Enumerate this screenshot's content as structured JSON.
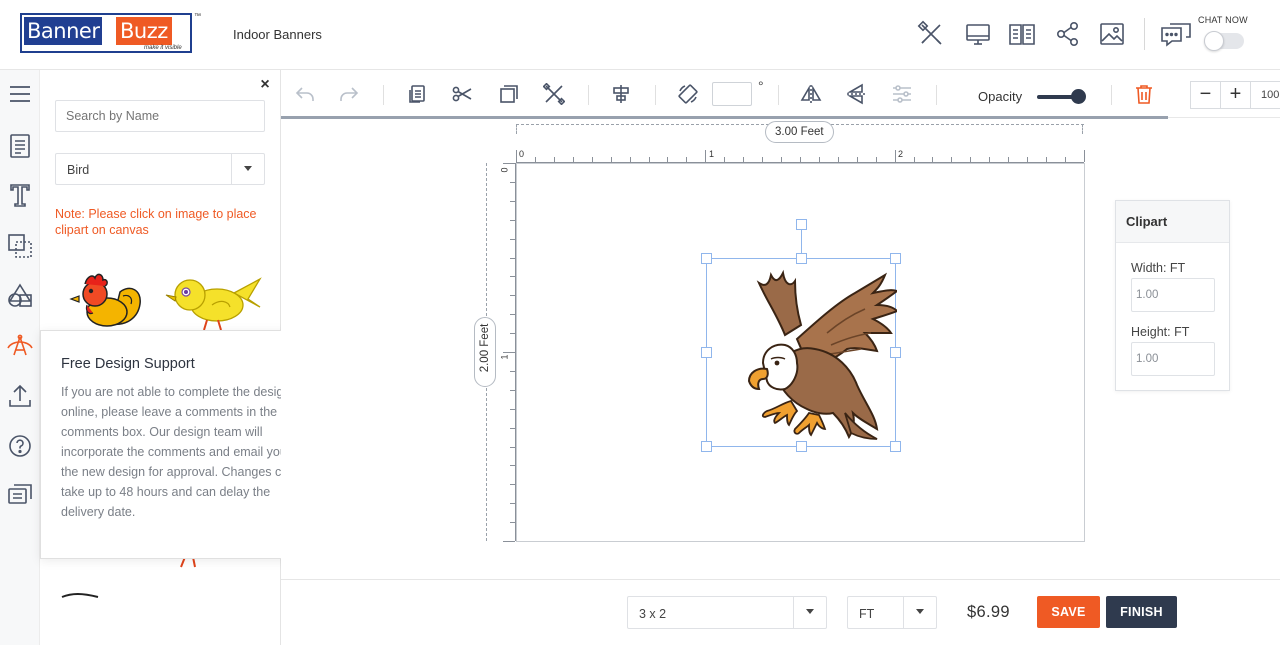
{
  "header": {
    "logo_part1": "Banner",
    "logo_part2": "Buzz",
    "logo_tagline": "make it visible",
    "logo_tm": "™",
    "product_title": "Indoor Banners",
    "chat_label": "CHAT NOW",
    "icons": [
      "tools-icon",
      "monitor-preview-icon",
      "book-guide-icon",
      "share-icon",
      "image-icon",
      "chat-icon"
    ]
  },
  "rail": {
    "items": [
      "menu-icon",
      "template-icon",
      "text-icon",
      "background-icon",
      "shapes-icon",
      "clipart-icon",
      "upload-icon",
      "help-icon",
      "comments-icon"
    ],
    "active": "clipart-icon"
  },
  "panel": {
    "search_placeholder": "Search by Name",
    "category": "Bird",
    "note": "Note: Please click on image to place clipart on canvas"
  },
  "support": {
    "title": "Free Design Support",
    "body": "If you are not able to complete the design online, please leave a comments in the comments box. Our design team will incorporate the comments and email you the new design for approval. Changes can take up to 48 hours and can delay the delivery date."
  },
  "toolbar": {
    "rotate_unit": "°",
    "opacity_label": "Opacity",
    "opacity_level": 1.0,
    "zoom_minus": "−",
    "zoom_plus": "+",
    "zoom_value": "100"
  },
  "canvas": {
    "width_label": "3.00 Feet",
    "height_label": "2.00 Feet",
    "ruler_h": [
      "0",
      "1",
      "2"
    ],
    "ruler_v": [
      "0",
      "1"
    ]
  },
  "props": {
    "title": "Clipart",
    "width_label": "Width: FT",
    "width_value": "1.00",
    "height_label": "Height: FT",
    "height_value": "1.00"
  },
  "bottom": {
    "size": "3 x 2",
    "unit": "FT",
    "price": "$6.99",
    "save": "SAVE",
    "finish": "FINISH"
  },
  "colors": {
    "accent": "#ef5a24",
    "dark": "#2f3a4e",
    "brand_blue": "#213f92",
    "selection": "#90b6ec"
  }
}
